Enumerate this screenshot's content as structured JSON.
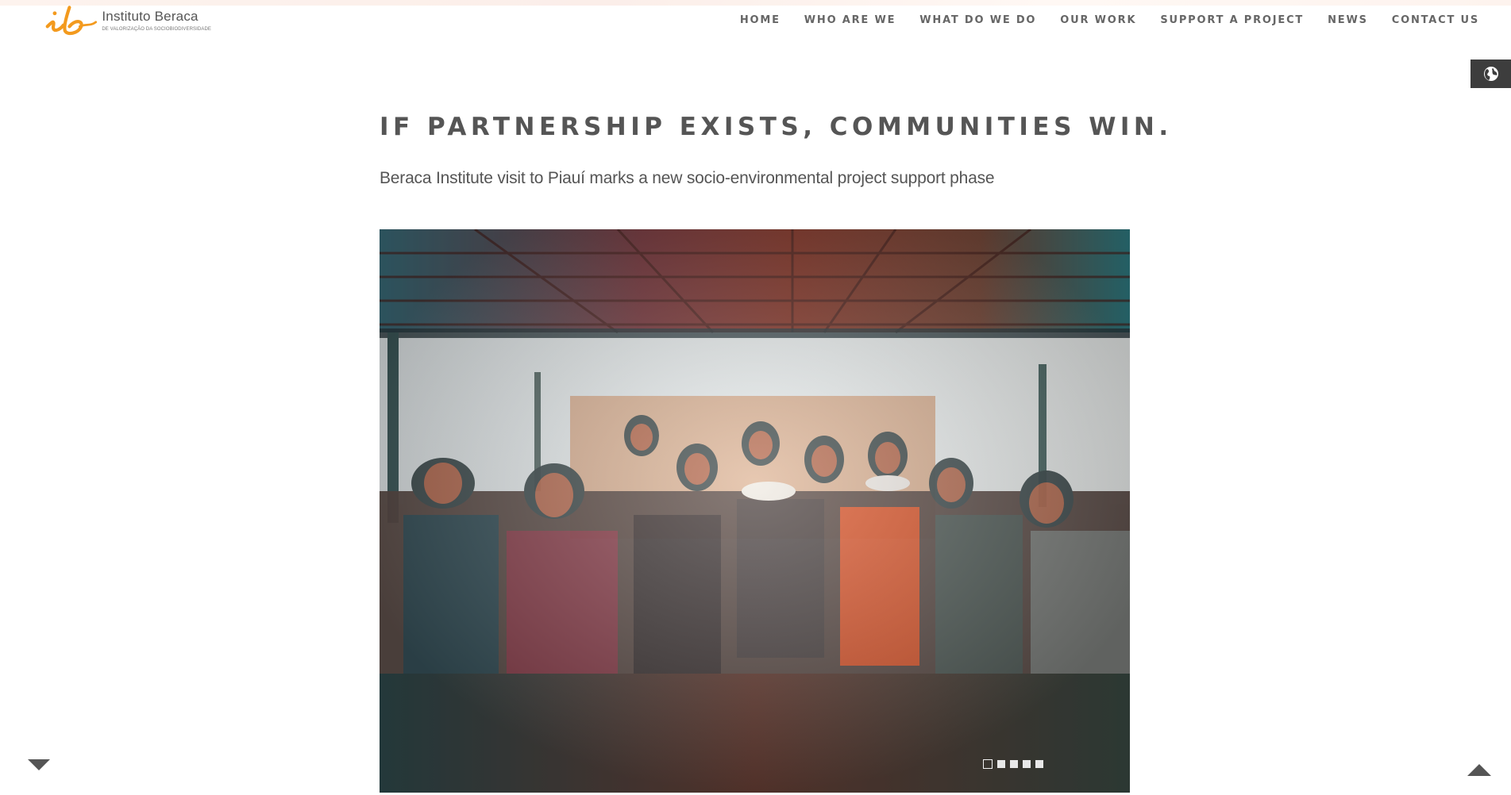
{
  "brand": {
    "name": "Instituto Beraca",
    "tagline": "DE VALORIZAÇÃO DA SOCIOBIODIVERSIDADE",
    "logo_icon": "ib-logo-icon",
    "accent": "#f39a1e"
  },
  "nav": {
    "items": [
      {
        "label": "HOME"
      },
      {
        "label": "WHO ARE WE"
      },
      {
        "label": "WHAT DO WE DO"
      },
      {
        "label": "OUR WORK"
      },
      {
        "label": "SUPPORT A PROJECT"
      },
      {
        "label": "NEWS"
      },
      {
        "label": "CONTACT US"
      }
    ]
  },
  "language_button": {
    "icon": "globe-icon"
  },
  "article": {
    "title": "IF PARTNERSHIP EXISTS, COMMUNITIES WIN.",
    "subtitle": "Beraca Institute visit to Piauí marks a new socio-environmental project support phase"
  },
  "slider": {
    "image_icon": "photo-group-under-shelter",
    "slide_count": 5,
    "active_slide": 1
  },
  "controls": {
    "scroll_down_icon": "triangle-down-icon",
    "scroll_up_icon": "triangle-up-icon"
  }
}
